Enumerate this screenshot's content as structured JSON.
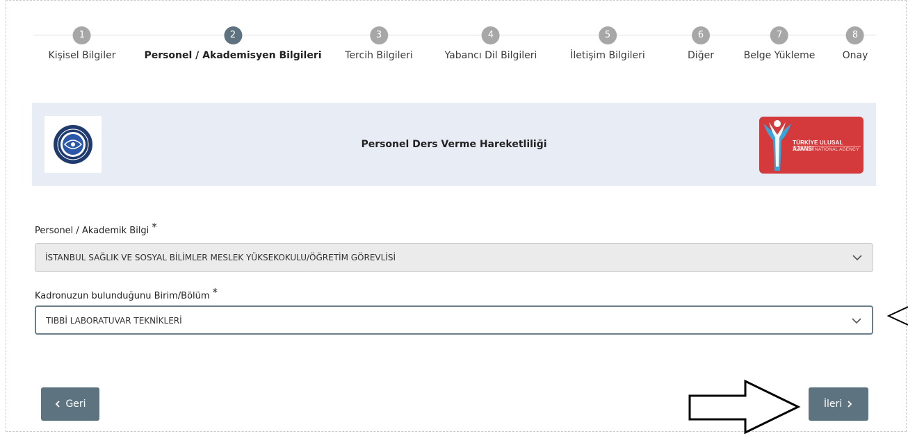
{
  "stepper": {
    "steps": [
      {
        "number": "1",
        "label": "Kişisel Bilgiler"
      },
      {
        "number": "2",
        "label": "Personel / Akademisyen Bilgileri"
      },
      {
        "number": "3",
        "label": "Tercih Bilgileri"
      },
      {
        "number": "4",
        "label": "Yabancı Dil Bilgileri"
      },
      {
        "number": "5",
        "label": "İletişim Bilgileri"
      },
      {
        "number": "6",
        "label": "Diğer"
      },
      {
        "number": "7",
        "label": "Belge Yükleme"
      },
      {
        "number": "8",
        "label": "Onay"
      }
    ],
    "active_step": "2"
  },
  "banner": {
    "title": "Personel Ders Verme Hareketliliği",
    "agency_logo": {
      "line1": "TÜRKİYE ULUSAL AJANSI",
      "line2": "TURKISH NATIONAL AGENCY"
    }
  },
  "form": {
    "personnel": {
      "label": "Personel / Akademik Bilgi",
      "required_mark": "*",
      "value": "İSTANBUL SAĞLIK VE SOSYAL BİLİMLER MESLEK YÜKSEKOKULU/ÖĞRETİM GÖREVLİSİ"
    },
    "department": {
      "label": "Kadronuzun bulunduğunu Birim/Bölüm",
      "required_mark": "*",
      "value": "TIBBİ LABORATUVAR TEKNİKLERİ"
    }
  },
  "buttons": {
    "back": "Geri",
    "next": "İleri"
  },
  "colors": {
    "primary": "#5d7380",
    "step_inactive": "#a7a7a7",
    "banner_bg": "#e8edf5",
    "agency_red": "#d43a3c"
  },
  "icons": {
    "back": "chevron-left-icon",
    "next": "chevron-right-icon",
    "dropdown": "chevron-down-icon",
    "annotation_arrow": "outline-right-arrow-icon",
    "annotation_pointer": "angle-left-icon"
  }
}
